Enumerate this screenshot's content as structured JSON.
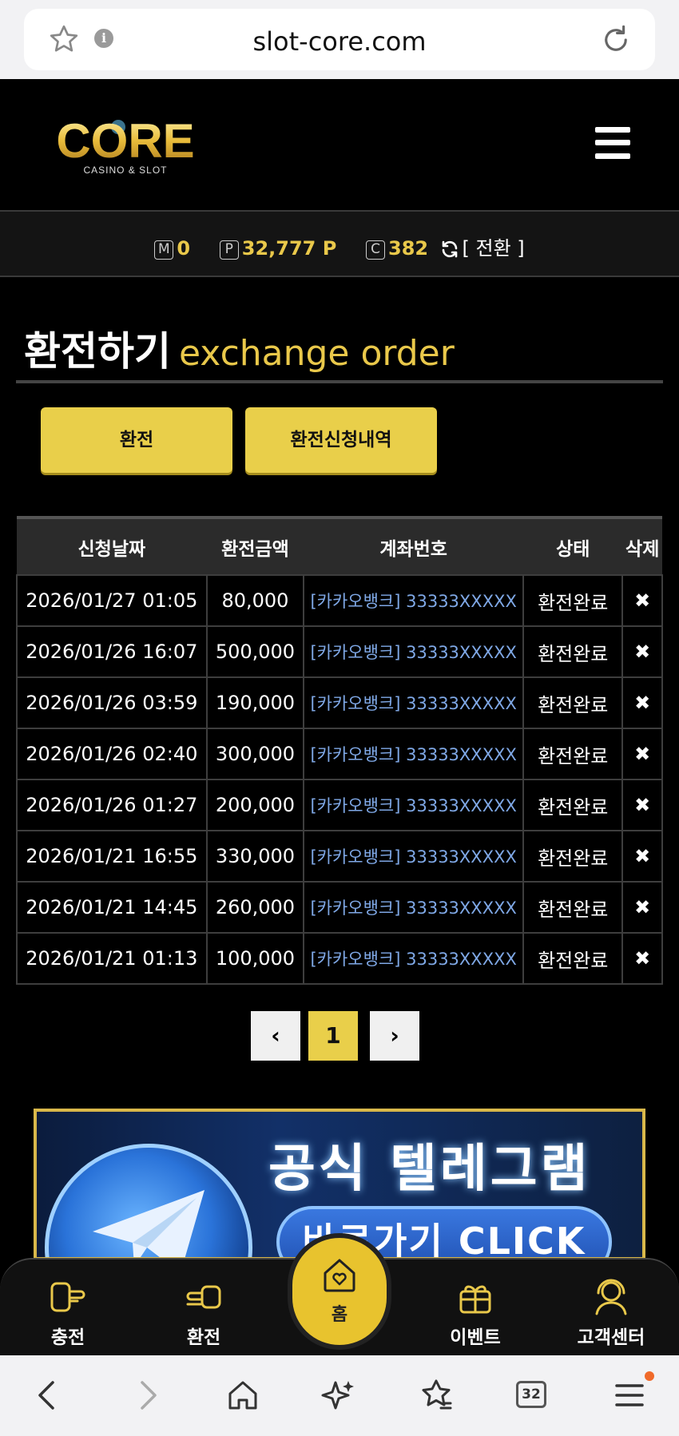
{
  "browser": {
    "url": "slot-core.com",
    "tab_count": "32"
  },
  "header": {
    "logo_text": "CORE",
    "logo_sub": "CASINO & SLOT"
  },
  "balance": {
    "money_label": "M",
    "money_value": "0",
    "point_label": "P",
    "point_value": "32,777 P",
    "coin_label": "C",
    "coin_value": "382",
    "convert_label": "[ 전환 ]"
  },
  "page": {
    "title_ko": "환전하기",
    "title_en": "exchange order"
  },
  "tabs": {
    "exchange": "환전",
    "history": "환전신청내역"
  },
  "table": {
    "headers": [
      "신청날짜",
      "환전금액",
      "계좌번호",
      "상태",
      "삭제"
    ],
    "rows": [
      {
        "date": "2026/01/27 01:05",
        "amount": "80,000",
        "account": "[카카오뱅크] 33333XXXXX",
        "status": "환전완료",
        "delete": "✖"
      },
      {
        "date": "2026/01/26 16:07",
        "amount": "500,000",
        "account": "[카카오뱅크] 33333XXXXX",
        "status": "환전완료",
        "delete": "✖"
      },
      {
        "date": "2026/01/26 03:59",
        "amount": "190,000",
        "account": "[카카오뱅크] 33333XXXXX",
        "status": "환전완료",
        "delete": "✖"
      },
      {
        "date": "2026/01/26 02:40",
        "amount": "300,000",
        "account": "[카카오뱅크] 33333XXXXX",
        "status": "환전완료",
        "delete": "✖"
      },
      {
        "date": "2026/01/26 01:27",
        "amount": "200,000",
        "account": "[카카오뱅크] 33333XXXXX",
        "status": "환전완료",
        "delete": "✖"
      },
      {
        "date": "2026/01/21 16:55",
        "amount": "330,000",
        "account": "[카카오뱅크] 33333XXXXX",
        "status": "환전완료",
        "delete": "✖"
      },
      {
        "date": "2026/01/21 14:45",
        "amount": "260,000",
        "account": "[카카오뱅크] 33333XXXXX",
        "status": "환전완료",
        "delete": "✖"
      },
      {
        "date": "2026/01/21 01:13",
        "amount": "100,000",
        "account": "[카카오뱅크] 33333XXXXX",
        "status": "환전완료",
        "delete": "✖"
      }
    ]
  },
  "pagination": {
    "prev": "‹",
    "current": "1",
    "next": "›"
  },
  "banner": {
    "title": "공식 텔레그램",
    "cta": "바로가기 CLICK"
  },
  "bottom_nav": {
    "deposit": "충전",
    "withdraw": "환전",
    "home": "홈",
    "event": "이벤트",
    "support": "고객센터"
  },
  "colors": {
    "accent": "#e9cf4a",
    "account_link": "#7fa8e6",
    "background": "#000000"
  }
}
